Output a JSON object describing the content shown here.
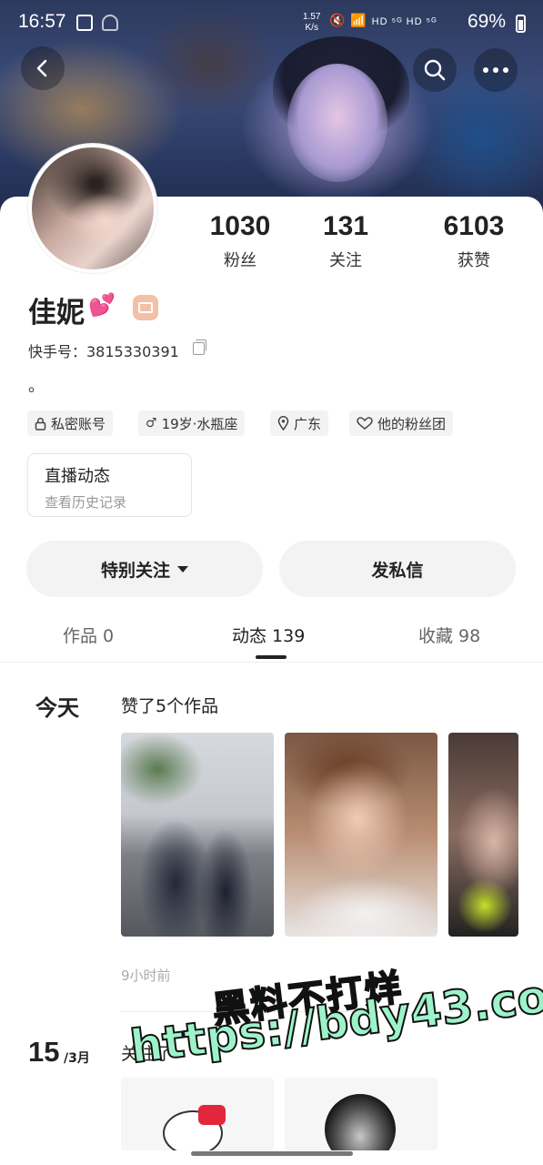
{
  "status_bar": {
    "time": "16:57",
    "net_speed_value": "1.57",
    "net_speed_unit": "K/s",
    "signal_text": "HD ⁵ᴳ HD ⁵ᴳ",
    "battery": "69%"
  },
  "header": {
    "back_icon": "chevron-left-icon",
    "search_icon": "search-icon",
    "more_icon": "more-dots-icon"
  },
  "profile": {
    "stats": [
      {
        "value": "1030",
        "label": "粉丝"
      },
      {
        "value": "131",
        "label": "关注"
      },
      {
        "value": "6103",
        "label": "获赞"
      }
    ],
    "name": "佳妮",
    "name_emoji": "💕",
    "kuaishou_id": "快手号：3815330391",
    "bio": "。",
    "tags": [
      {
        "icon": "lock-icon",
        "label": "私密账号"
      },
      {
        "icon": "male-icon",
        "label": "19岁·水瓶座"
      },
      {
        "icon": "location-icon",
        "label": "广东"
      },
      {
        "icon": "fan-club-icon",
        "label": "他的粉丝团"
      }
    ],
    "live_box": {
      "title": "直播动态",
      "subtitle": "查看历史记录"
    }
  },
  "actions": {
    "follow_label": "特别关注",
    "message_label": "发私信"
  },
  "tabs": [
    {
      "label": "作品 0"
    },
    {
      "label": "动态 139",
      "active": true
    },
    {
      "label": "收藏 98"
    }
  ],
  "feed": [
    {
      "day": "今天",
      "action": "赞了5个作品",
      "time_ago": "9小时前"
    },
    {
      "day_num": "15",
      "day_month": "/3月",
      "action": "关注了"
    }
  ],
  "watermark": {
    "line1": "黑料不打烊",
    "line2": "https://bdy43.co"
  },
  "colors": {
    "accent_text": "#222222",
    "muted_text": "#999999",
    "watermark_fill": "#9df3c9"
  }
}
